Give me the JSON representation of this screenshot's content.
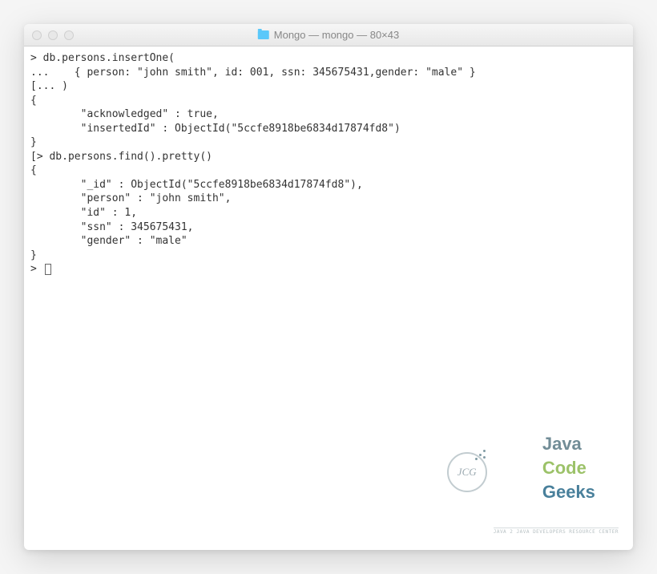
{
  "window": {
    "title": "Mongo — mongo — 80×43"
  },
  "terminal": {
    "lines": [
      "> db.persons.insertOne(",
      "...    { person: \"john smith\", id: 001, ssn: 345675431,gender: \"male\" }",
      "[... )",
      "{",
      "        \"acknowledged\" : true,",
      "        \"insertedId\" : ObjectId(\"5ccfe8918be6834d17874fd8\")",
      "}",
      "[> db.persons.find().pretty()",
      "{",
      "        \"_id\" : ObjectId(\"5ccfe8918be6834d17874fd8\"),",
      "        \"person\" : \"john smith\",",
      "        \"id\" : 1,",
      "        \"ssn\" : 345675431,",
      "        \"gender\" : \"male\"",
      "}",
      "> "
    ]
  },
  "watermark": {
    "badge": "JCG",
    "java": "Java",
    "code": "Code",
    "geeks": "Geeks",
    "sub": "Java 2 Java Developers Resource Center"
  }
}
